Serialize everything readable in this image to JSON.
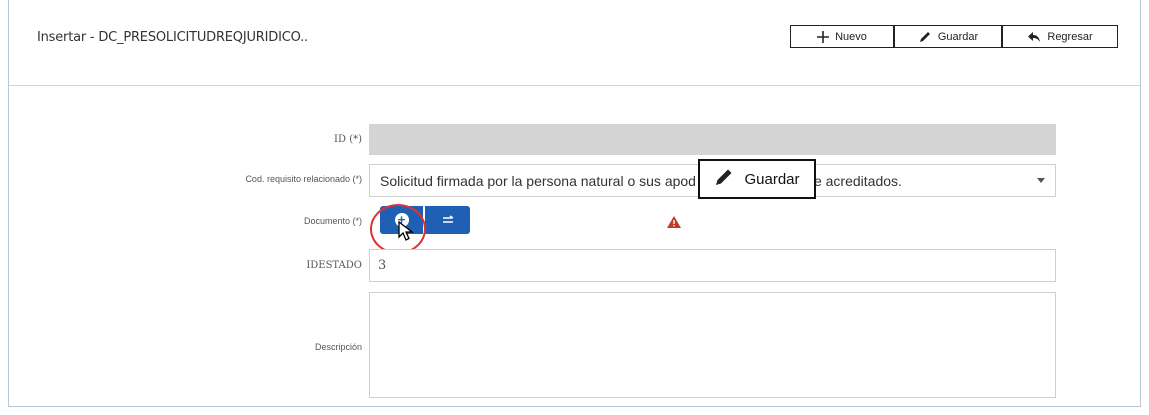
{
  "header": {
    "title": "Insertar - DC_PRESOLICITUDREQJURIDICO..",
    "toolbar": {
      "new_label": "Nuevo",
      "save_label": "Guardar",
      "back_label": "Regresar"
    }
  },
  "form": {
    "id": {
      "label": "ID (*)",
      "value": ""
    },
    "requisito": {
      "label": "Cod. requisito relacionado (*)",
      "value_before": "Solicitud firmada por la persona natural o sus apod",
      "value_after": "e acreditados."
    },
    "documento": {
      "label": "Documento (*)"
    },
    "idestado": {
      "label": "IDESTADO",
      "value": "3"
    },
    "descripcion": {
      "label": "Descripción",
      "value": ""
    }
  },
  "tooltip": {
    "label": "Guardar"
  },
  "colors": {
    "primary_button": "#1f5fb4",
    "warning": "#c0392b",
    "highlight_ring": "#dd3333"
  },
  "icons": {
    "new": "plus-icon",
    "save": "pencil-icon",
    "back": "reply-arrow-icon",
    "upload": "plus-circle-icon",
    "scan": "scan-icon",
    "warning": "warning-triangle-icon",
    "cursor": "mouse-pointer-icon"
  }
}
